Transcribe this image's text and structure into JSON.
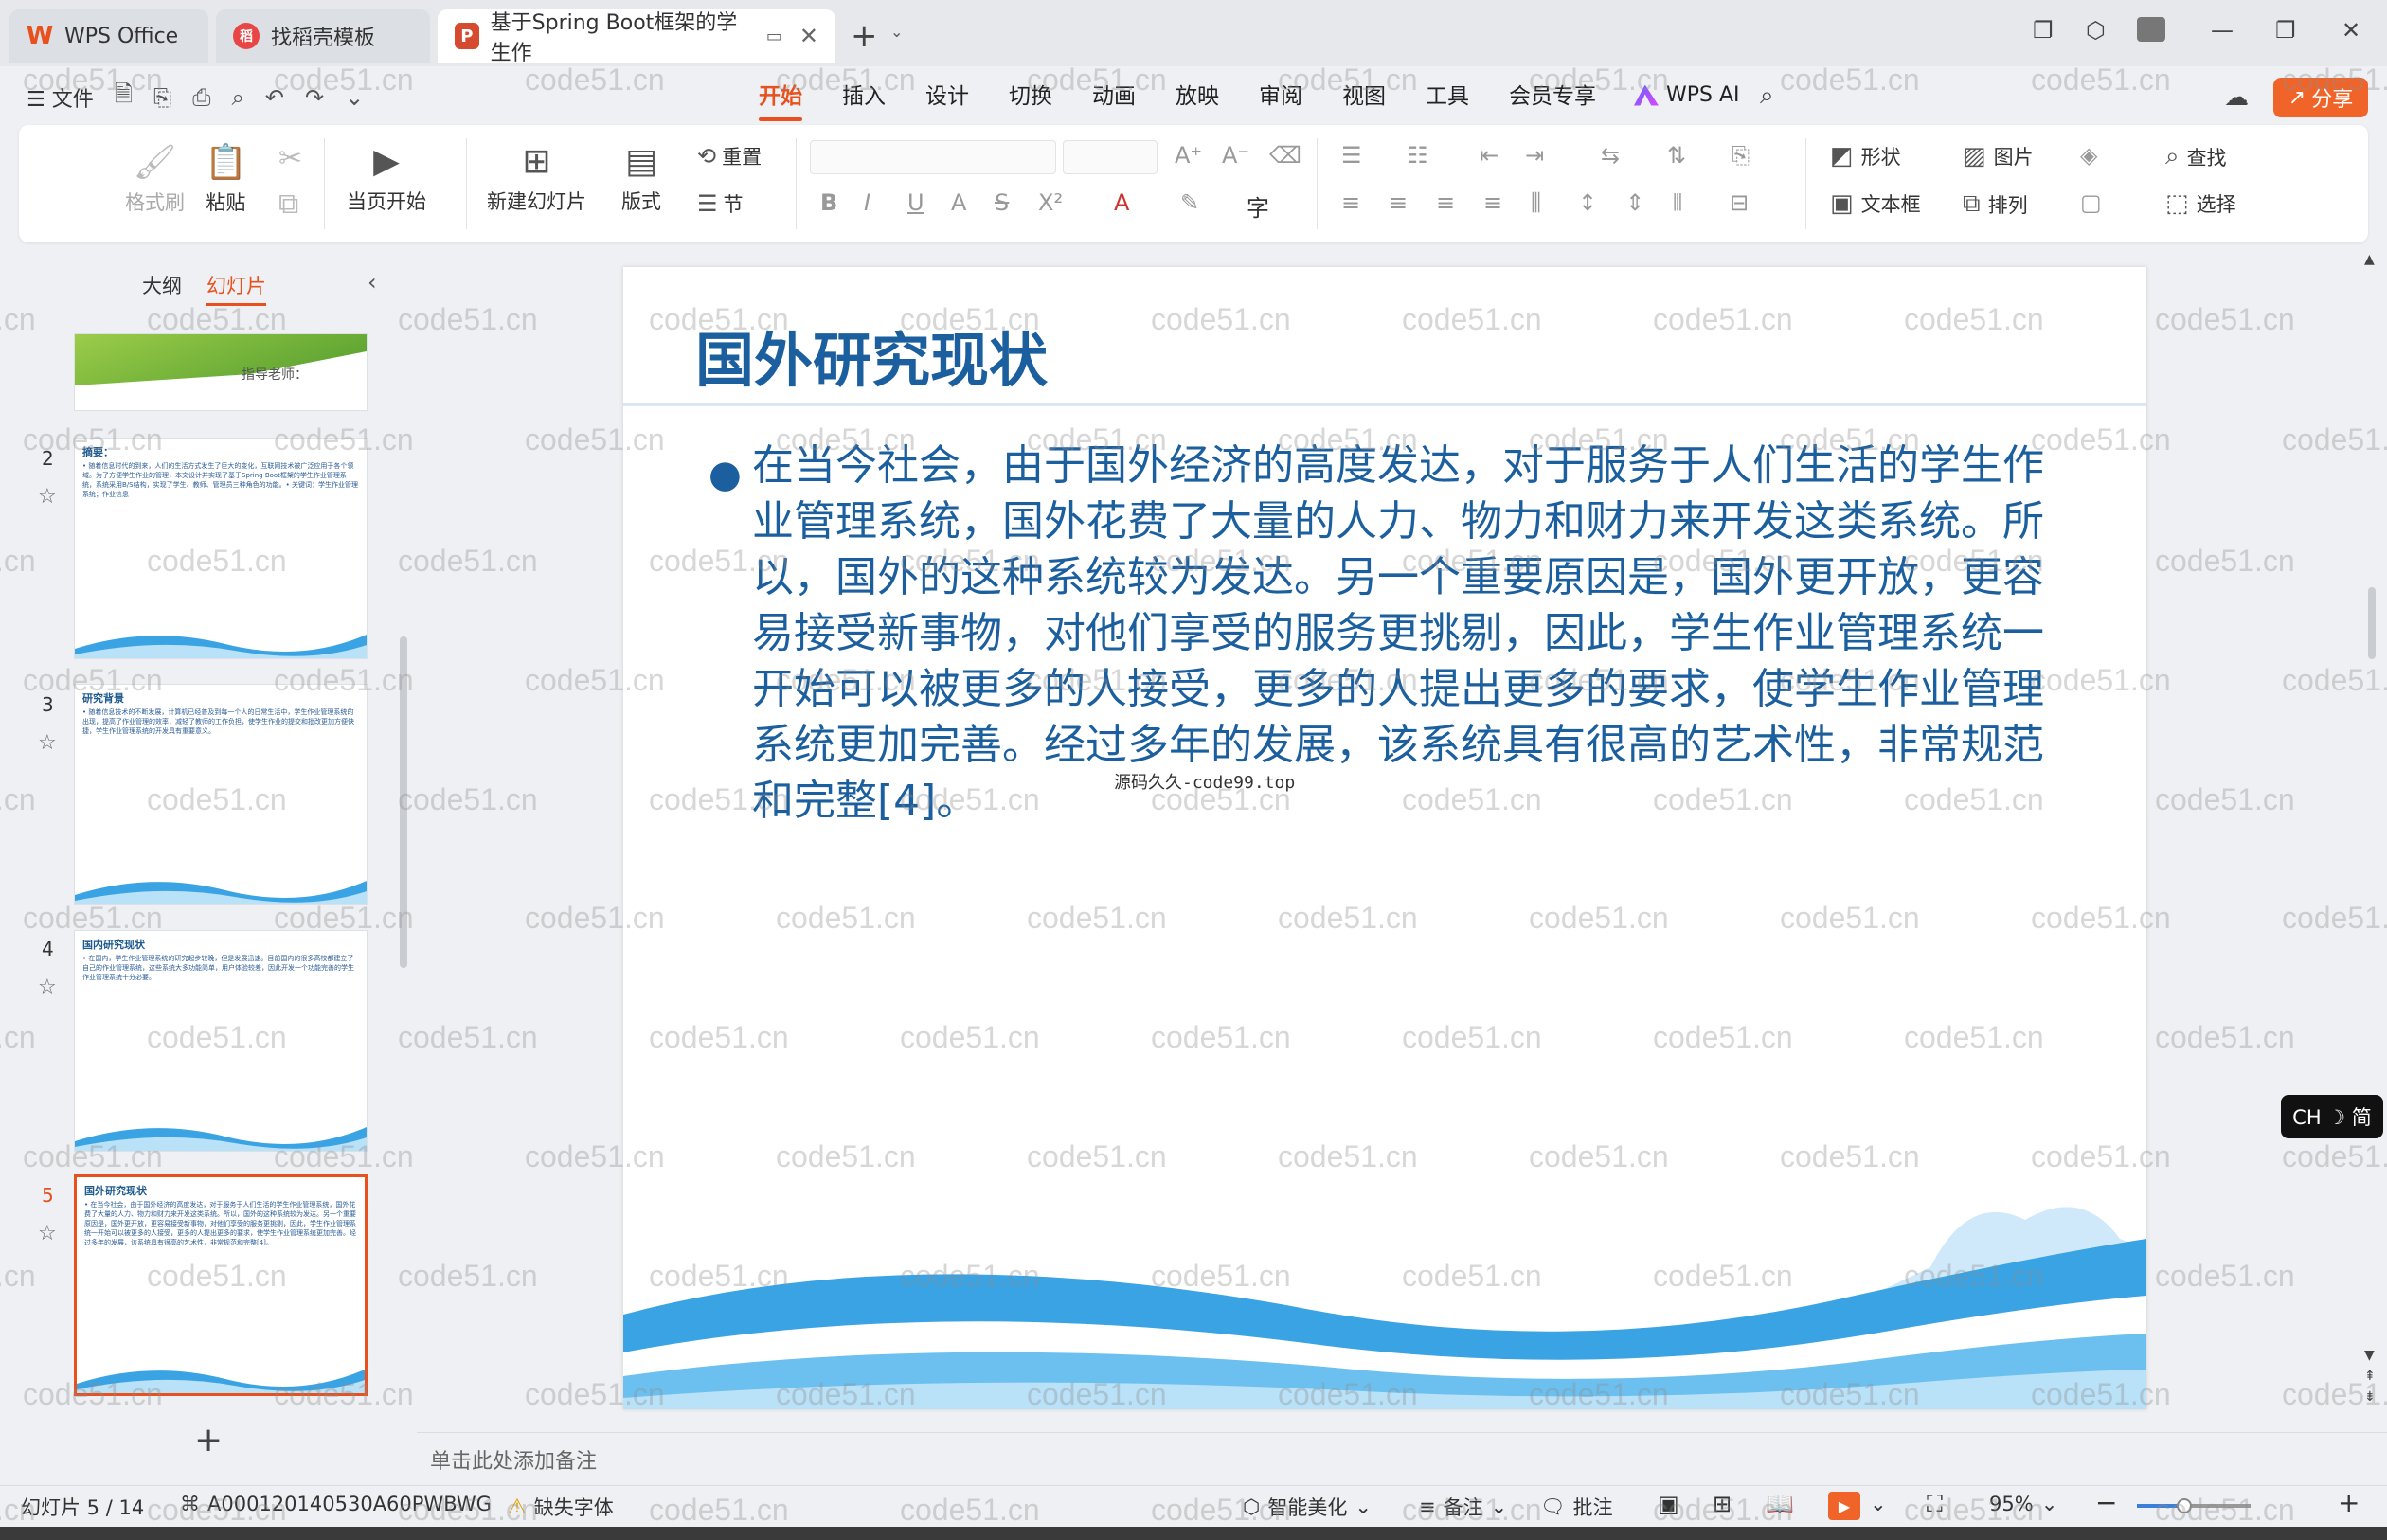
{
  "titlebar": {
    "tabs": [
      {
        "label": "WPS Office",
        "logo": "W",
        "color": "#e8511e"
      },
      {
        "label": "找稻壳模板",
        "logo": "稻",
        "color": "#e84545"
      },
      {
        "label": "基于Spring Boot框架的学生作",
        "logo": "P",
        "color": "#d64b2f"
      }
    ]
  },
  "menu": {
    "file_label": "文件",
    "tabs": [
      "开始",
      "插入",
      "设计",
      "切换",
      "动画",
      "放映",
      "审阅",
      "视图",
      "工具",
      "会员专享"
    ],
    "active_tab": "开始",
    "wps_ai": "WPS AI",
    "share": "分享"
  },
  "ribbon": {
    "format_painter": "格式刷",
    "paste": "粘贴",
    "play_from_current": "当页开始",
    "new_slide": "新建幻灯片",
    "layout": "版式",
    "reset": "重置",
    "section": "节",
    "shape": "形状",
    "picture": "图片",
    "find": "查找",
    "textbox": "文本框",
    "arrange": "排列",
    "select": "选择"
  },
  "left_panel": {
    "tab_outline": "大纲",
    "tab_slides": "幻灯片",
    "thumbnails": [
      {
        "num": "",
        "title": "",
        "text": "指导老师："
      },
      {
        "num": "2",
        "title": "摘要：",
        "text": "• 随着信息时代的到来，人们的生活方式发生了巨大的变化，互联网技术被广泛应用于各个领域。为了方便学生作业的管理，本文设计并实现了基于Spring Boot框架的学生作业管理系统，系统采用B/S结构，实现了学生、教师、管理员三种角色的功能。• 关键词：学生作业管理系统；作业信息"
      },
      {
        "num": "3",
        "title": "研究背景",
        "text": "• 随着信息技术的不断发展，计算机已经普及到每一个人的日常生活中，学生作业管理系统的出现，提高了作业管理的效率，减轻了教师的工作负担，使学生作业的提交和批改更加方便快捷，学生作业管理系统的开发具有重要意义。"
      },
      {
        "num": "4",
        "title": "国内研究现状",
        "text": "• 在国内，学生作业管理系统的研究起步较晚，但是发展迅速。目前国内的很多高校都建立了自己的作业管理系统，这些系统大多功能简单，用户体验较差，因此开发一个功能完善的学生作业管理系统十分必要。"
      },
      {
        "num": "5",
        "title": "国外研究现状",
        "text": "• 在当今社会，由于国外经济的高度发达，对于服务于人们生活的学生作业管理系统，国外花费了大量的人力、物力和财力来开发这类系统。所以，国外的这种系统较为发达。另一个重要原因是，国外更开放，更容易接受新事物，对他们享受的服务更挑剔，因此，学生作业管理系统一开始可以被更多的人接受，更多的人提出更多的要求，使学生作业管理系统更加完善。经过多年的发展，该系统具有很高的艺术性，非常规范和完整[4]。"
      }
    ],
    "selected": "5"
  },
  "slide": {
    "title": "国外研究现状",
    "body": "在当今社会，由于国外经济的高度发达，对于服务于人们生活的学生作业管理系统，国外花费了大量的人力、物力和财力来开发这类系统。所以，国外的这种系统较为发达。另一个重要原因是，国外更开放，更容易接受新事物，对他们享受的服务更挑剔，因此，学生作业管理系统一开始可以被更多的人接受，更多的人提出更多的要求，使学生作业管理系统更加完善。经过多年的发展，该系统具有很高的艺术性，非常规范和完整[4]。",
    "center_watermark": "源码久久-code99.top"
  },
  "ime": "CH ☽ 简",
  "notes_placeholder": "单击此处添加备注",
  "status": {
    "slide_count": "幻灯片 5 / 14",
    "doc_id": "A000120140530A60PWBWG",
    "missing_font": "缺失字体",
    "beautify": "智能美化",
    "notes": "备注",
    "comments": "批注",
    "zoom": "95%",
    "zoom_level": 0.42
  },
  "watermark_text": "code51.cn"
}
